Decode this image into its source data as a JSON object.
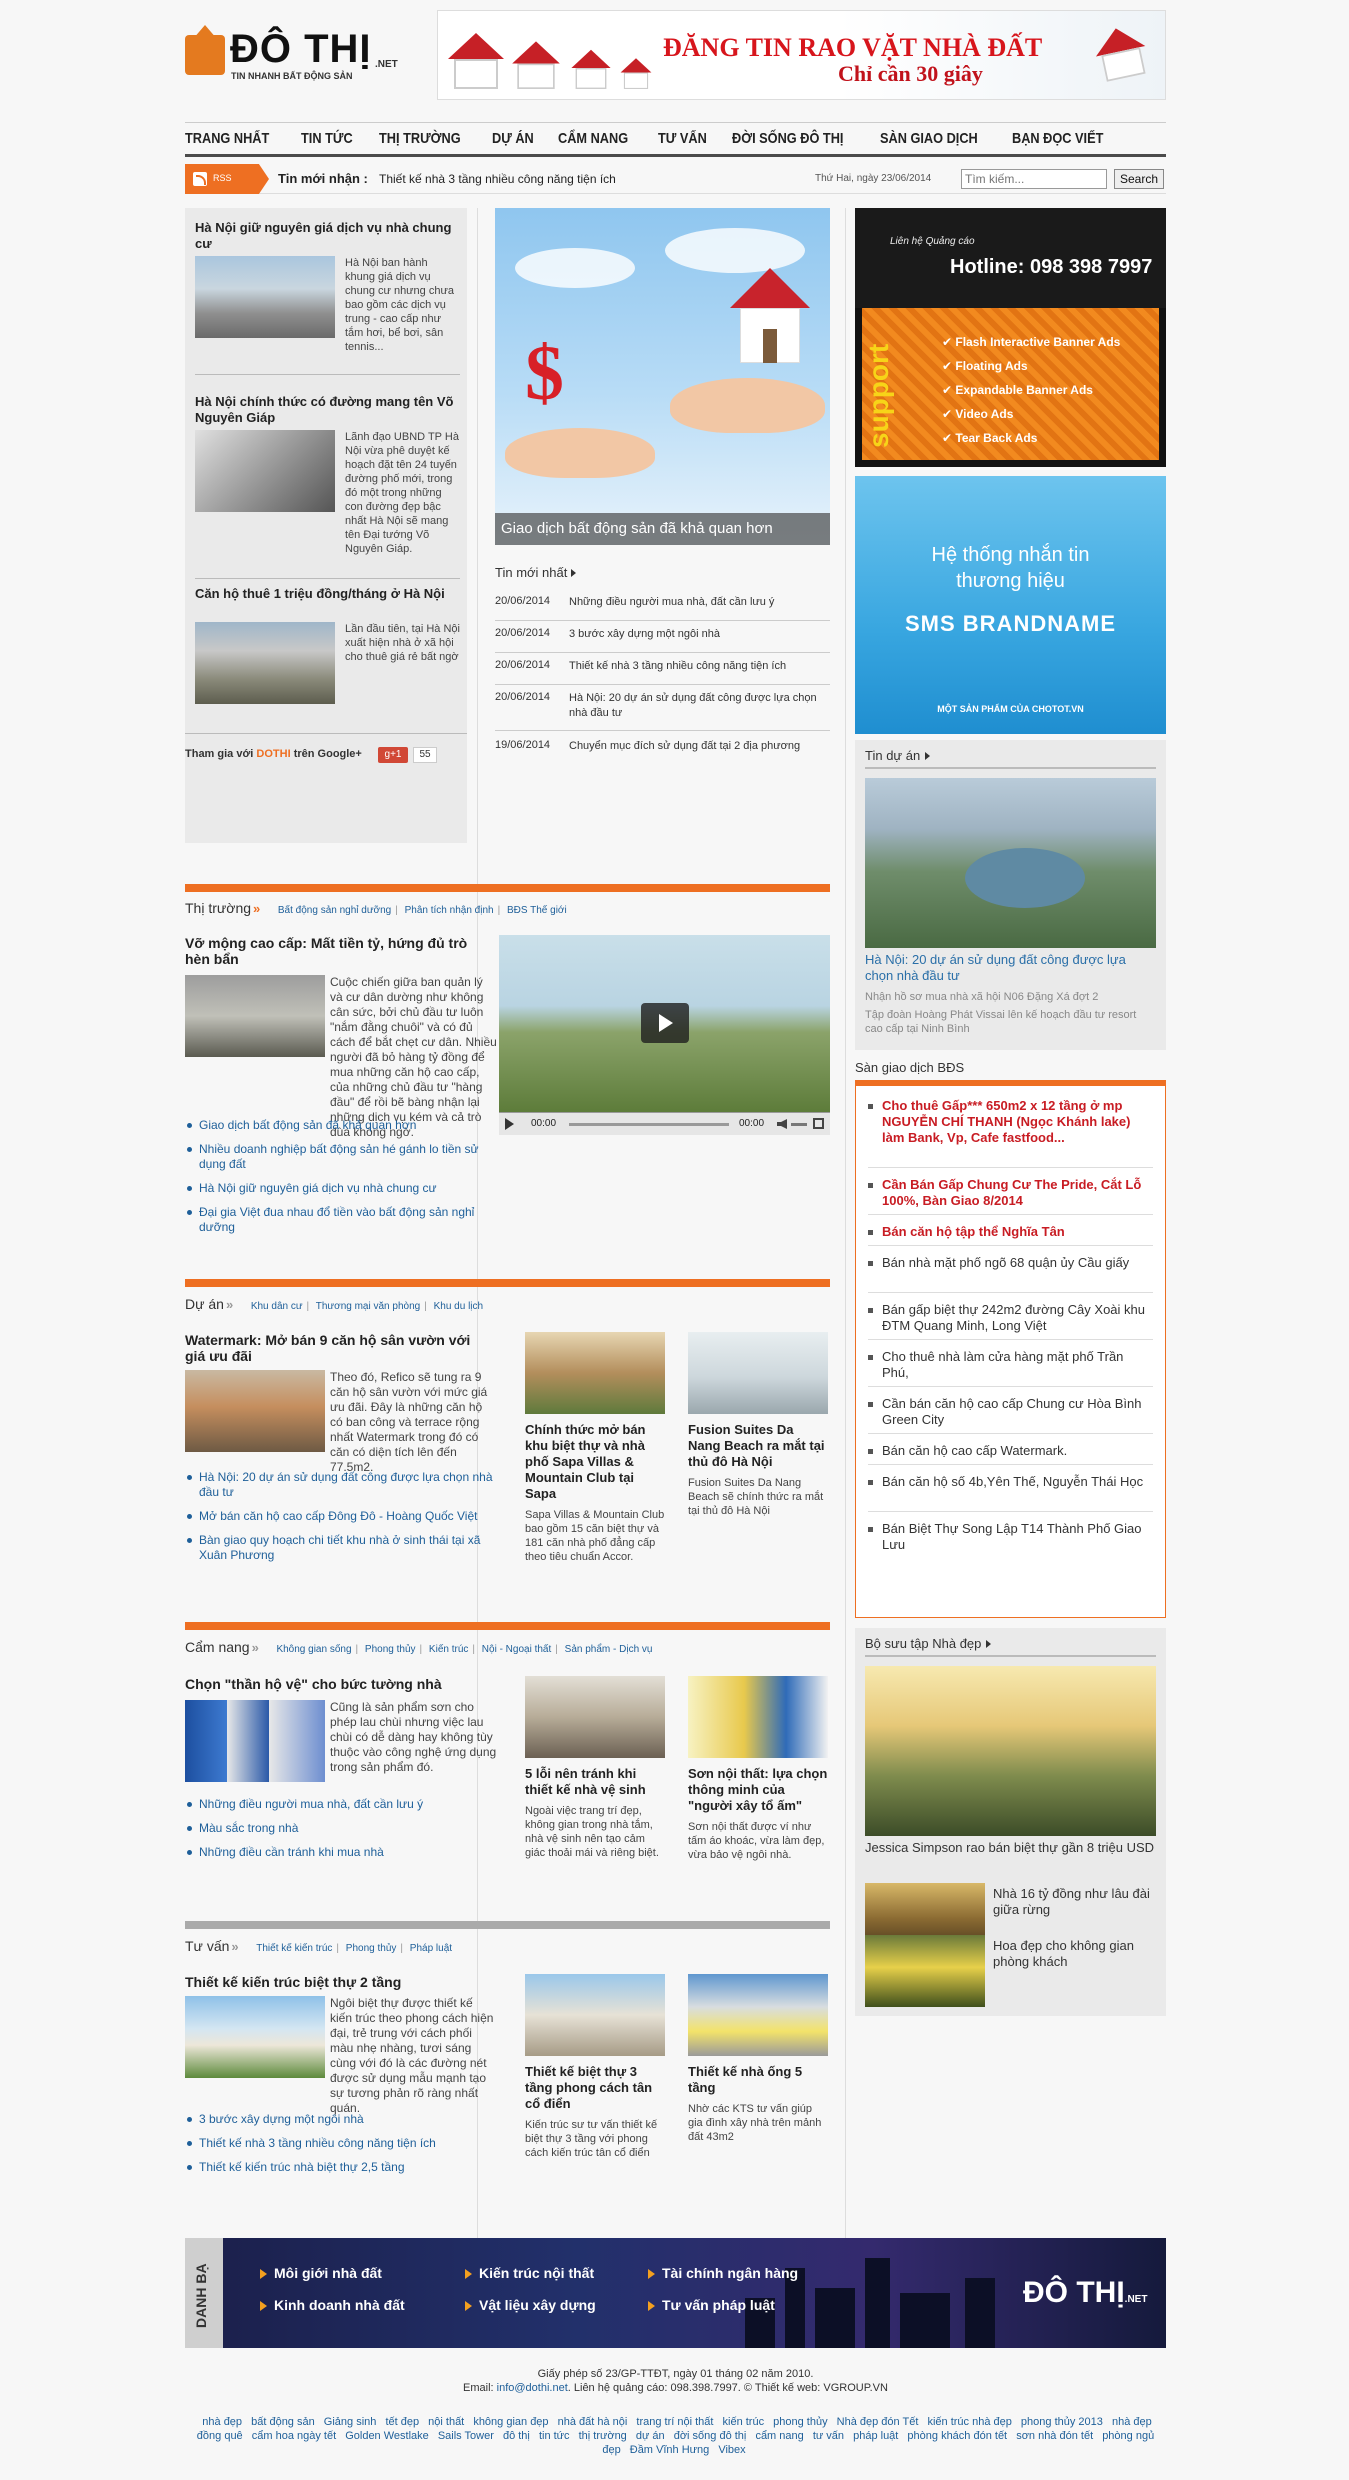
{
  "header": {
    "logo_text": "ĐÔ THỊ",
    "logo_net": ".NET",
    "logo_tagline": "TIN NHANH BẤT ĐỘNG SẢN",
    "banner_title": "ĐĂNG TIN RAO VẶT NHÀ ĐẤT",
    "banner_sub": "Chỉ cần 30 giây"
  },
  "nav": [
    "TRANG NHẤT",
    "TIN TỨC",
    "THỊ TRƯỜNG",
    "DỰ ÁN",
    "CẨM NANG",
    "TƯ VẤN",
    "ĐỜI SỐNG ĐÔ THỊ",
    "SÀN GIAO DỊCH",
    "BẠN ĐỌC VIẾT"
  ],
  "ticker": {
    "rss_label": "RSS",
    "label": "Tin mới nhận :",
    "text": "Thiết kế nhà 3 tầng nhiều công năng tiện ích",
    "date": "Thứ Hai, ngày 23/06/2014",
    "search_placeholder": "Tìm kiếm...",
    "search_button": "Search"
  },
  "left_news": [
    {
      "title": "Hà Nội giữ nguyên giá dịch vụ nhà chung cư",
      "text": "Hà Nội ban hành khung giá dịch vụ chung cư nhưng chưa bao gồm các dịch vụ trung - cao cấp như tắm hơi, bể bơi, sân tennis..."
    },
    {
      "title": "Hà Nội chính thức có đường mang tên Võ Nguyên Giáp",
      "text": "Lãnh đạo UBND TP Hà Nội vừa phê duyệt kế hoạch đặt tên 24 tuyến đường phố mới, trong đó một trong những con đường đẹp bậc nhất Hà Nội sẽ mang tên Đại tướng Võ Nguyên Giáp."
    },
    {
      "title": "Căn hộ thuê 1 triệu đồng/tháng ở Hà Nội",
      "text": "Lần đầu tiên, tại Hà Nội xuất hiện nhà ở xã hội cho thuê giá rẻ bất ngờ"
    }
  ],
  "gplus": {
    "prefix": "Tham gia với",
    "brand": "DOTHI",
    "suffix": "trên Google+",
    "button": "g+1",
    "count": "55"
  },
  "feature": {
    "caption": "Giao dịch bất động sản đã khả quan hơn"
  },
  "latest": {
    "title": "Tin mới nhất",
    "items": [
      {
        "date": "20/06/2014",
        "text": "Những điều người mua nhà, đất cần lưu ý"
      },
      {
        "date": "20/06/2014",
        "text": "3 bước xây dựng một ngôi nhà"
      },
      {
        "date": "20/06/2014",
        "text": "Thiết kế nhà 3 tầng nhiều công năng tiện ích"
      },
      {
        "date": "20/06/2014",
        "text": "Hà Nội: 20 dự án sử dụng đất công được lựa chọn nhà đầu tư"
      },
      {
        "date": "19/06/2014",
        "text": "Chuyển mục đích sử dụng đất tại 2 địa phương"
      }
    ]
  },
  "ad1": {
    "lien_he": "Liên hệ Quảng cáo",
    "hotline": "Hotline: 098 398 7997",
    "support": "support",
    "items": [
      "Flash Interactive Banner Ads",
      "Floating Ads",
      "Expandable Banner Ads",
      "Video Ads",
      "Tear Back Ads"
    ]
  },
  "ad2": {
    "line1": "Hệ thống nhắn tin",
    "line2": "thương hiệu",
    "line3": "SMS BRANDNAME",
    "line4": "MỘT SẢN PHẨM CỦA CHOTOT.VN"
  },
  "tin_du_an": {
    "title": "Tin dự án",
    "caption": "Hà Nội: 20 dự án sử dụng đất công được lựa chọn nhà đầu tư",
    "sub": [
      "Nhận hồ sơ mua nhà xã hội N06 Đặng Xá đợt 2",
      "Tập đoàn Hoàng Phát Vissai lên kế hoạch đầu tư resort cao cấp tại Ninh Bình"
    ]
  },
  "san_giao_dich": {
    "title": "Sàn giao dịch BĐS",
    "items": [
      {
        "text": "Cho thuê Gấp*** 650m2 x 12 tầng ở mp NGUYỄN CHÍ THANH (Ngọc Khánh lake) làm Bank, Vp, Cafe fastfood...",
        "hot": true
      },
      {
        "text": "Cần Bán Gấp Chung Cư The Pride, Cắt Lỗ 100%, Bàn Giao 8/2014",
        "hot": true
      },
      {
        "text": "Bán căn hộ tập thể Nghĩa Tân",
        "hot": true
      },
      {
        "text": "Bán nhà mặt phố ngõ 68 quận ủy Cầu giấy",
        "hot": false
      },
      {
        "text": "Bán gấp biệt thự 242m2 đường Cây Xoài khu ĐTM Quang Minh, Long Việt",
        "hot": false
      },
      {
        "text": "Cho thuê nhà làm cửa hàng mặt phố Trần Phú,",
        "hot": false
      },
      {
        "text": "Cần bán căn hộ cao cấp Chung cư Hòa Bình Green City",
        "hot": false
      },
      {
        "text": "Bán căn hộ cao cấp Watermark.",
        "hot": false
      },
      {
        "text": "Bán căn hộ số 4b,Yên Thế, Nguyễn Thái Học",
        "hot": false
      },
      {
        "text": "Bán Biệt Thự Song Lập T14 Thành Phố Giao Lưu",
        "hot": false
      }
    ]
  },
  "bo_suu_tap": {
    "title": "Bộ sưu tập Nhà đẹp",
    "caption": "Jessica Simpson rao bán biệt thự gần 8 triệu USD",
    "small": [
      "Nhà 16 tỷ đồng như lâu đài giữa rừng",
      "Hoa đẹp cho không gian phòng khách"
    ]
  },
  "thi_truong": {
    "title": "Thị trường",
    "subs": [
      "Bất động sản nghỉ dưỡng",
      "Phân tích nhận định",
      "BĐS Thế giới"
    ],
    "lead_title": "Vỡ mộng cao cấp: Mất tiền tỷ, hứng đủ trò hèn bẩn",
    "lead_text": "Cuộc chiến giữa ban quản lý và cư dân dường như không cân sức, bởi chủ đầu tư luôn \"nắm đằng chuôi\" và có đủ cách để bắt chẹt cư dân. Nhiều người đã bỏ hàng tỷ đồng để mua những căn hộ cao cấp, của những chủ đầu tư \"hàng đầu\" để rồi bẽ bàng nhận lại những dịch vụ kém và cả trò đùa không ngờ.",
    "bullets": [
      "Giao dịch bất động sản đã khả quan hơn",
      "Nhiều doanh nghiệp bất động sản hé gánh lo tiền sử dụng đất",
      "Hà Nội giữ nguyên giá dịch vụ nhà chung cư",
      "Đại gia Việt đua nhau đổ tiền vào bất động sản nghỉ dưỡng"
    ],
    "video_time_left": "00:00",
    "video_time_right": "00:00"
  },
  "du_an": {
    "title": "Dự án",
    "subs": [
      "Khu dân cư",
      "Thương mại văn phòng",
      "Khu du lịch"
    ],
    "lead_title": "Watermark: Mở bán 9 căn hộ sân vườn với giá ưu đãi",
    "lead_text": "Theo đó, Refico sẽ tung ra 9 căn hộ sân vườn với mức giá ưu đãi. Đây là những căn hộ có ban công và terrace rộng nhất Watermark trong đó có căn có diện tích lên đến 77.5m2.",
    "bullets": [
      "Hà Nội: 20 dự án sử dụng đất công được lựa chọn nhà đầu tư",
      "Mở bán căn hộ cao cấp Đông Đô - Hoàng Quốc Việt",
      "Bàn giao quy hoạch chi tiết khu nhà ở sinh thái tại xã Xuân Phương"
    ],
    "cards": [
      {
        "title": "Chính thức mở bán khu biệt thự và nhà phố Sapa Villas & Mountain Club tại Sapa",
        "text": "Sapa Villas & Mountain Club bao gồm 15 căn biệt thự và 181 căn nhà phố đẳng cấp theo tiêu chuẩn Accor."
      },
      {
        "title": "Fusion Suites Da Nang Beach ra mắt tại thủ đô Hà Nội",
        "text": "Fusion Suites Da Nang Beach sẽ chính thức ra mắt tại thủ đô Hà Nội"
      }
    ]
  },
  "cam_nang": {
    "title": "Cẩm nang",
    "subs": [
      "Không gian sống",
      "Phong thủy",
      "Kiến trúc",
      "Nội - Ngoại thất",
      "Sản phẩm - Dịch vụ"
    ],
    "lead_title": "Chọn \"thần hộ vệ\" cho bức tường nhà",
    "lead_text": "Cũng là sản phẩm sơn cho phép lau chùi nhưng việc lau chùi có dễ dàng hay không tùy thuộc vào công nghệ ứng dụng trong sản phẩm đó.",
    "bullets": [
      "Những điều người mua nhà, đất cần lưu ý",
      "Màu sắc trong nhà",
      "Những điều cần tránh khi mua nhà"
    ],
    "cards": [
      {
        "title": "5 lỗi nên tránh khi thiết kế nhà vệ sinh",
        "text": "Ngoài việc trang trí đẹp, không gian trong nhà tắm, nhà vệ sinh nên tạo cảm giác thoải mái và riêng biệt."
      },
      {
        "title": "Sơn nội thất: lựa chọn thông minh của \"người xây tổ ấm\"",
        "text": "Sơn nội thất được ví như tấm áo khoác, vừa làm đẹp, vừa bảo vệ ngôi nhà."
      }
    ]
  },
  "tu_van": {
    "title": "Tư vấn",
    "subs": [
      "Thiết kế kiến trúc",
      "Phong thủy",
      "Pháp luật"
    ],
    "lead_title": "Thiết kế kiến trúc biệt thự 2 tầng",
    "lead_text": "Ngôi biệt thự được thiết kế kiến trúc theo phong cách hiện đại, trẻ trung với cách phối màu nhẹ nhàng, tươi sáng cùng với đó là các đường nét được sử dụng mẫu mạnh tạo sự tương phản rõ ràng nhất quán.",
    "bullets": [
      "3 bước xây dựng một ngôi nhà",
      "Thiết kế nhà 3 tầng nhiều công năng tiện ích",
      "Thiết kế kiến trúc nhà biệt thự 2,5 tầng"
    ],
    "cards": [
      {
        "title": "Thiết kế biệt thự 3 tầng phong cách tân cổ điển",
        "text": "Kiến trúc sư tư vấn thiết kế biệt thự 3 tầng với phong cách kiến trúc tân cổ điển"
      },
      {
        "title": "Thiết kế nhà ống 5 tầng",
        "text": "Nhờ các KTS tư vấn giúp gia đình xây nhà trên mảnh đất 43m2"
      }
    ]
  },
  "footer": {
    "side_label": "DANH BẠ",
    "links": [
      "Môi giới nhà đất",
      "Kiến trúc nội thất",
      "Tài chính ngân hàng",
      "Kinh doanh nhà đất",
      "Vật liệu xây dựng",
      "Tư vấn pháp luật"
    ],
    "logo": "ĐÔ THỊ",
    "logo_net": ".NET",
    "license": "Giấy phép số 23/GP-TTĐT, ngày 01 tháng 02 năm 2010.",
    "email_label": "Email:",
    "email": "info@dothi.net",
    "contact": ". Liên hệ quảng cáo: 098.398.7997. © Thiết kế web: VGROUP.VN",
    "tags": [
      "nhà đẹp",
      "bất động sản",
      "Giảng sinh",
      "tết đẹp",
      "nội thất",
      "không gian đẹp",
      "nhà đất hà nội",
      "trang trí nội thất",
      "kiến trúc",
      "phong thủy",
      "Nhà đẹp đón Tết",
      "kiến trúc nhà đẹp",
      "phong thủy 2013",
      "nhà đẹp đồng quê",
      "cẩm hoa ngày tết",
      "Golden Westlake",
      "Sails Tower",
      "đô thị",
      "tin tức",
      "thị trường",
      "dự án",
      "đời sống đô thị",
      "cẩm nang",
      "tư vấn",
      "pháp luật",
      "phòng khách đón tết",
      "sơn nhà đón tết",
      "phòng ngủ đẹp",
      "Đầm Vĩnh Hưng",
      "Vibex"
    ]
  },
  "colors": {
    "accent": "#ee6f22",
    "link": "#1e5f99",
    "hot": "#c81c23",
    "nav_border": "#4b4b4b"
  }
}
